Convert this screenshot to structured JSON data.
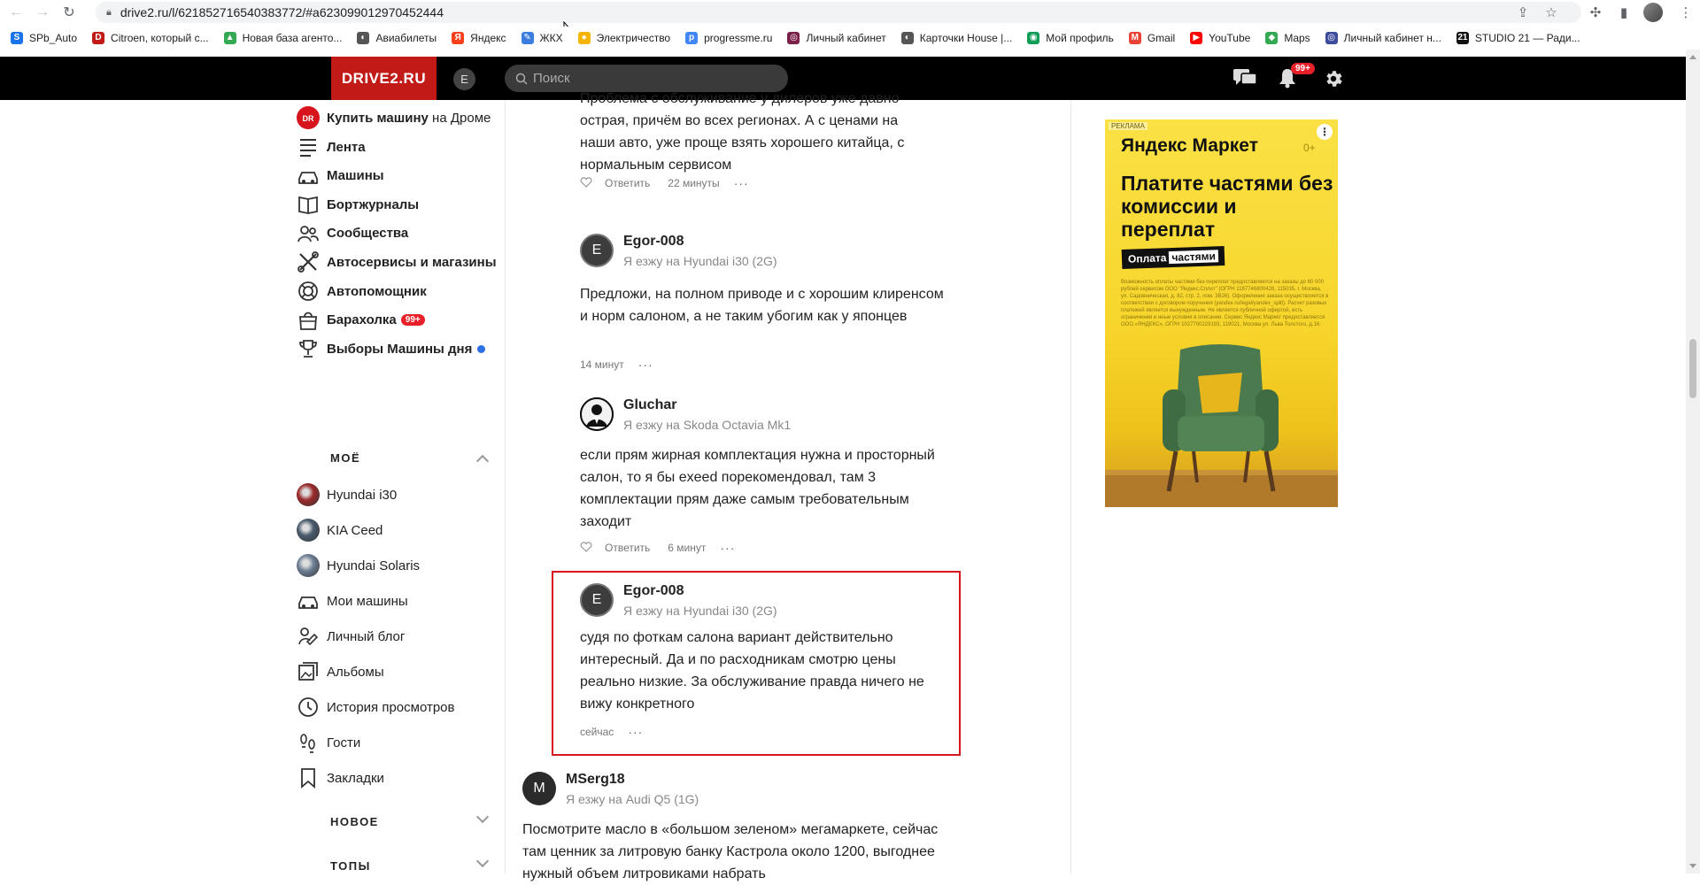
{
  "browser": {
    "url": "drive2.ru/l/621852716540383772/#a623099012970452444",
    "bookmarks": [
      {
        "label": "SPb_Auto",
        "color": "#1a73e8",
        "glyph": "S"
      },
      {
        "label": "Citroen, который с...",
        "color": "#c21b17",
        "glyph": "D"
      },
      {
        "label": "Новая база агенто...",
        "color": "#34a853",
        "glyph": "▲"
      },
      {
        "label": "Авиабилеты",
        "color": "#555555",
        "glyph": "◐"
      },
      {
        "label": "Яндекс",
        "color": "#fc3f1d",
        "glyph": "Я"
      },
      {
        "label": "ЖКХ",
        "color": "#3b7ddd",
        "glyph": "✎"
      },
      {
        "label": "Электричество",
        "color": "#f4b400",
        "glyph": "●"
      },
      {
        "label": "progressme.ru",
        "color": "#4285f4",
        "glyph": "p"
      },
      {
        "label": "Личный кабинет",
        "color": "#7a1f4a",
        "glyph": "◎"
      },
      {
        "label": "Карточки House |...",
        "color": "#555555",
        "glyph": "◐"
      },
      {
        "label": "Мой профиль",
        "color": "#0f9d58",
        "glyph": "◉"
      },
      {
        "label": "Gmail",
        "color": "#ea4335",
        "glyph": "M"
      },
      {
        "label": "YouTube",
        "color": "#ff0000",
        "glyph": "▶"
      },
      {
        "label": "Maps",
        "color": "#34a853",
        "glyph": "◆"
      },
      {
        "label": "Личный кабинет н...",
        "color": "#3c4b9c",
        "glyph": "◎"
      },
      {
        "label": "STUDIO 21 — Ради...",
        "color": "#111111",
        "glyph": "21"
      }
    ]
  },
  "header": {
    "logo": "DRIVE2.RU",
    "avatar_letter": "E",
    "search_placeholder": "Поиск",
    "notifications_badge": "99+"
  },
  "sidebar": {
    "buy": {
      "bold": "Купить машину",
      "light": " на Дроме"
    },
    "items": [
      {
        "label": "Лента",
        "icon": "feed-icon"
      },
      {
        "label": "Машины",
        "icon": "car-icon"
      },
      {
        "label": "Бортжурналы",
        "icon": "book-icon"
      },
      {
        "label": "Сообщества",
        "icon": "people-icon"
      },
      {
        "label": "Автосервисы и магазины",
        "icon": "tools-icon"
      },
      {
        "label": "Автопомощник",
        "icon": "lifebuoy-icon"
      },
      {
        "label": "Барахолка",
        "icon": "bag-icon",
        "badge": "99+"
      },
      {
        "label": "Выборы Машины дня",
        "icon": "trophy-icon"
      }
    ],
    "section_mine": "МОЁ",
    "mine": [
      {
        "label": "Hyundai i30",
        "thumb": "#9b2a2a"
      },
      {
        "label": "KIA Ceed",
        "thumb": "#4a5b6e"
      },
      {
        "label": "Hyundai Solaris",
        "thumb": "#6e7f96"
      },
      {
        "label": "Мои машины",
        "icon": "car-icon"
      },
      {
        "label": "Личный блог",
        "icon": "blog-icon"
      },
      {
        "label": "Альбомы",
        "icon": "album-icon"
      },
      {
        "label": "История просмотров",
        "icon": "history-icon"
      },
      {
        "label": "Гости",
        "icon": "footprints-icon"
      },
      {
        "label": "Закладки",
        "icon": "bookmark-icon"
      }
    ],
    "section_new": "НОВОЕ",
    "section_top": "ТОПЫ"
  },
  "comments": [
    {
      "text": "Проблема с обслуживание у дилеров уже давно острая, причём во всех регионах. А с ценами на наши авто, уже проще взять хорошего китайца, с нормальным сервисом",
      "reply": "Ответить",
      "time": "22 минуты"
    },
    {
      "author": "Egor-008",
      "avatar_letter": "E",
      "avatar_color": "#3d3d3d",
      "sub": "Я езжу на Hyundai i30 (2G)",
      "text": "Предложи, на полном приводе и с хорошим клиренсом и норм салоном, а не таким убогим как у японцев",
      "time": "14 минут"
    },
    {
      "author": "Gluchar",
      "avatar_letter": "",
      "avatar_color": "#1a1a1a",
      "sub": "Я езжу на Skoda Octavia Mk1",
      "text": "если прям жирная комплектация нужна и просторный салон, то я бы exeed порекомендовал, там 3 комплектации прям даже самым требовательным заходит",
      "reply": "Ответить",
      "time": "6 минут"
    },
    {
      "author": "Egor-008",
      "avatar_letter": "E",
      "avatar_color": "#3d3d3d",
      "sub": "Я езжу на Hyundai i30 (2G)",
      "text": "судя по фоткам салона вариант действительно интересный. Да и по расходникам смотрю цены реально низкие. За обслуживание правда ничего не вижу конкретного",
      "time": "сейчас"
    },
    {
      "author": "MSerg18",
      "avatar_letter": "M",
      "avatar_color": "#2b2b2b",
      "sub": "Я езжу на Audi Q5 (1G)",
      "text": "Посмотрите масло в «большом зеленом» мегамаркете, сейчас там ценник за литровую банку Кастрола около 1200, выгоднее нужный объем литровиками набрать"
    }
  ],
  "ad": {
    "label": "РЕКЛАМА",
    "brand": "Яндекс Маркет",
    "age": "0+",
    "headline": "Платите частями без комиссии и переплат",
    "pill_a": "Оплата",
    "pill_b": "частями",
    "fine": "Возможность оплаты частями без переплат предоставляется на заказы до 60 000 рублей сервисом ООО \"Яндекс.Сплит\" (ОГРН 1187746800426, 115035, г. Москва, ул. Садовническая, д. 82, стр. 2, пом. 3В26). Оформление заказа осуществляется в соответствии с договором поручения (yandex.ru/legal/yandex_split). Расчет разовых платежей является вынужденным. Не является публичной офертой, есть ограничения и иные условия в описании. Сервис Яндекс Маркет предоставляется ООО «ЯНДЕКС», ОГРН 1027700229193, 119021, Москва ул. Льва Толстого, д.16."
  }
}
